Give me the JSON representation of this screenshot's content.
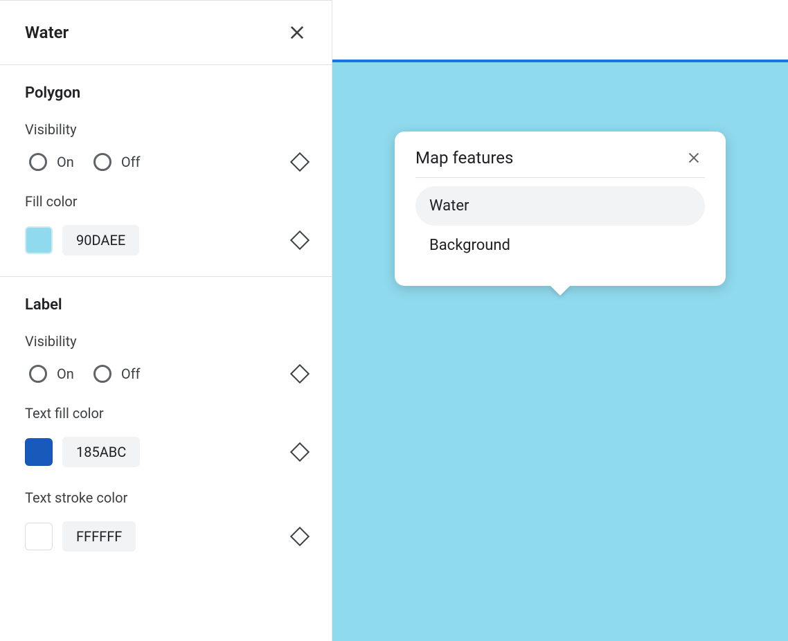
{
  "panel": {
    "title": "Water",
    "close_name": "close-icon"
  },
  "polygon": {
    "title": "Polygon",
    "visibility": {
      "label": "Visibility",
      "on": "On",
      "off": "Off"
    },
    "fill": {
      "label": "Fill color",
      "hex": "90DAEE",
      "swatch": "#90DAEE"
    }
  },
  "label_section": {
    "title": "Label",
    "visibility": {
      "label": "Visibility",
      "on": "On",
      "off": "Off"
    },
    "text_fill": {
      "label": "Text fill color",
      "hex": "185ABC",
      "swatch": "#185ABC"
    },
    "text_stroke": {
      "label": "Text stroke color",
      "hex": "FFFFFF",
      "swatch": "#FFFFFF"
    }
  },
  "preview": {
    "water_color": "#90DAEE",
    "accent": "#1a73e8"
  },
  "popup": {
    "title": "Map features",
    "items": [
      {
        "label": "Water",
        "selected": true
      },
      {
        "label": "Background",
        "selected": false
      }
    ]
  }
}
